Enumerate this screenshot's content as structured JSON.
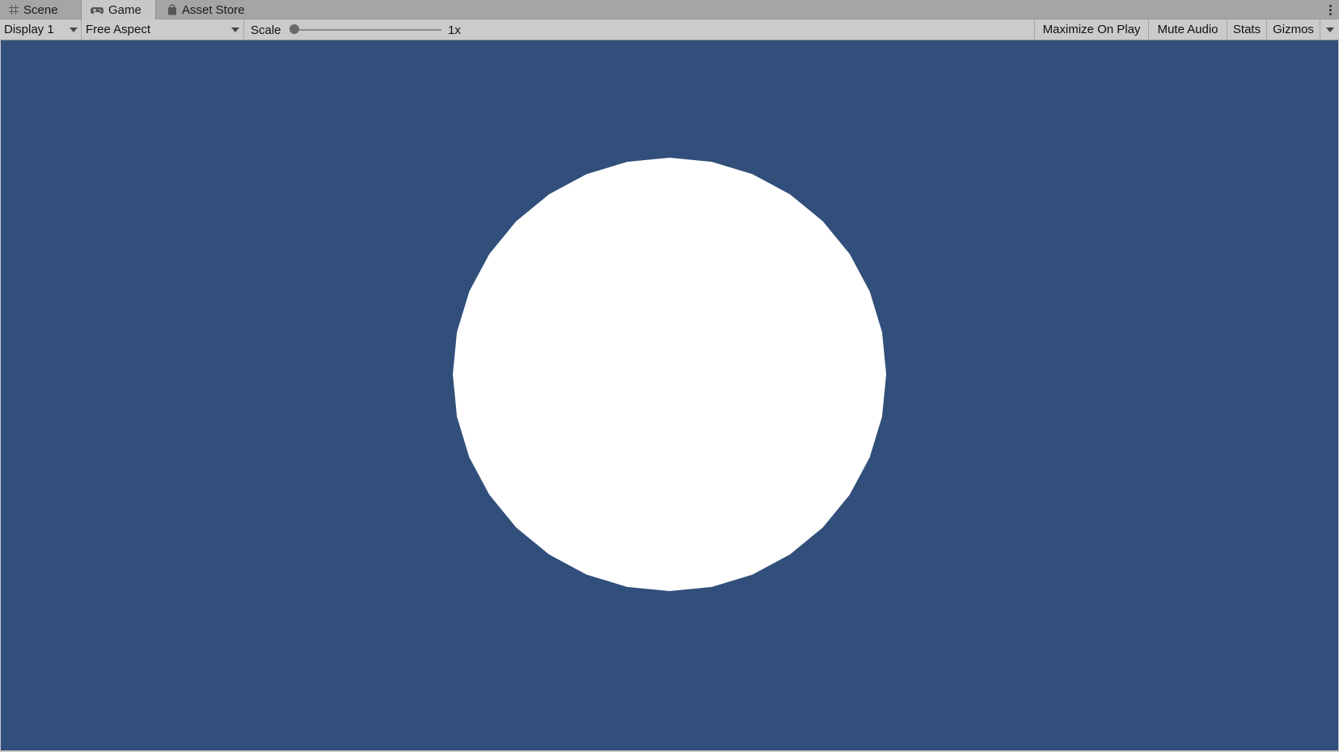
{
  "tabs": [
    {
      "label": "Scene",
      "icon": "grid-icon",
      "active": false
    },
    {
      "label": "Game",
      "icon": "gamepad-icon",
      "active": true
    },
    {
      "label": "Asset Store",
      "icon": "shopping-bag-icon",
      "active": false
    }
  ],
  "toolbar": {
    "display_label": "Display 1",
    "aspect_label": "Free Aspect",
    "scale_label": "Scale",
    "scale_value": "1x",
    "scale_slider_fraction": 0,
    "maximize_label": "Maximize On Play",
    "mute_label": "Mute Audio",
    "stats_label": "Stats",
    "gizmos_label": "Gizmos"
  },
  "game_view": {
    "background_color": "#314f7a",
    "object": {
      "shape": "circle",
      "color": "#ffffff"
    }
  }
}
